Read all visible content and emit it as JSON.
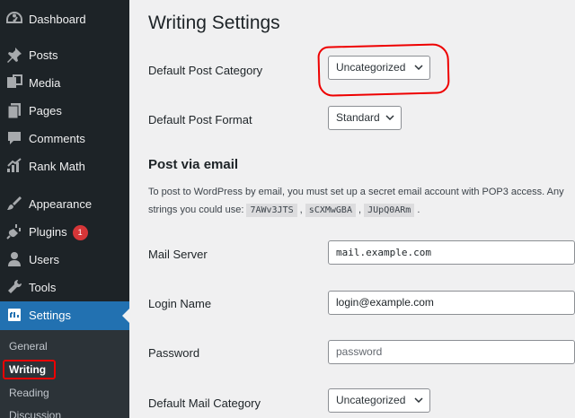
{
  "sidebar": {
    "items": [
      {
        "label": "Dashboard",
        "icon": "dashboard-icon"
      },
      {
        "label": "Posts",
        "icon": "pin-icon"
      },
      {
        "label": "Media",
        "icon": "media-icon"
      },
      {
        "label": "Pages",
        "icon": "pages-icon"
      },
      {
        "label": "Comments",
        "icon": "comment-icon"
      },
      {
        "label": "Rank Math",
        "icon": "chart-icon"
      },
      {
        "label": "Appearance",
        "icon": "brush-icon"
      },
      {
        "label": "Plugins",
        "icon": "plug-icon",
        "badge": "1"
      },
      {
        "label": "Users",
        "icon": "users-icon"
      },
      {
        "label": "Tools",
        "icon": "wrench-icon"
      },
      {
        "label": "Settings",
        "icon": "settings-icon"
      }
    ],
    "submenu": [
      "General",
      "Writing",
      "Reading",
      "Discussion"
    ]
  },
  "page": {
    "title": "Writing Settings",
    "default_post_category_label": "Default Post Category",
    "default_post_category_value": "Uncategorized",
    "default_post_format_label": "Default Post Format",
    "default_post_format_value": "Standard",
    "post_via_email_title": "Post via email",
    "email_desc_line1": "To post to WordPress by email, you must set up a secret email account with POP3 access. Any",
    "email_desc_line2_prefix": "strings you could use:",
    "random_strings": [
      "7AWv3JTS",
      "sCXMwGBA",
      "JUpQ0ARm"
    ],
    "mail_server_label": "Mail Server",
    "mail_server_value": "mail.example.com",
    "login_name_label": "Login Name",
    "login_name_value": "login@example.com",
    "password_label": "Password",
    "password_value": "password",
    "default_mail_category_label": "Default Mail Category",
    "default_mail_category_value": "Uncategorized"
  },
  "colors": {
    "sidebar_bg": "#1d2327",
    "active": "#2271b1",
    "annotation": "#e00000"
  }
}
